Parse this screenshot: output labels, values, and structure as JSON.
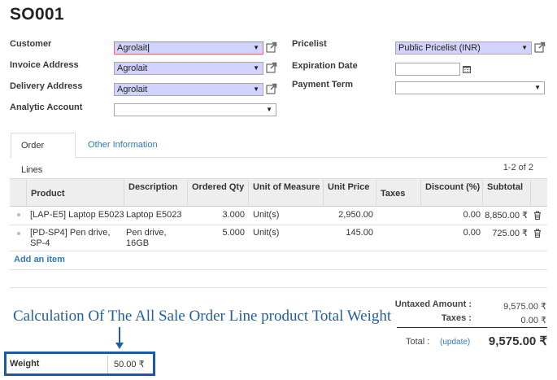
{
  "record": {
    "title": "SO001"
  },
  "left_fields": {
    "customer": {
      "label": "Customer",
      "value": "Agrolait"
    },
    "invoice_address": {
      "label": "Invoice Address",
      "value": "Agrolait"
    },
    "delivery_address": {
      "label": "Delivery Address",
      "value": "Agrolait"
    },
    "analytic_account": {
      "label": "Analytic Account",
      "value": ""
    }
  },
  "right_fields": {
    "pricelist": {
      "label": "Pricelist",
      "value": "Public Pricelist (INR)"
    },
    "expiration_date": {
      "label": "Expiration Date",
      "value": ""
    },
    "payment_term": {
      "label": "Payment Term",
      "value": ""
    }
  },
  "tabs": [
    {
      "label": "Order Lines",
      "active": true
    },
    {
      "label": "Other Information",
      "active": false
    }
  ],
  "pager": "1-2 of 2",
  "table": {
    "columns": [
      "Product",
      "Description",
      "Ordered Qty",
      "Unit of Measure",
      "Unit Price",
      "Taxes",
      "Discount (%)",
      "Subtotal"
    ],
    "rows": [
      {
        "product": [
          "[LAP-E5] Laptop E5023"
        ],
        "description": [
          "Laptop E5023"
        ],
        "qty": "3.000",
        "uom": "Unit(s)",
        "price": "2,950.00",
        "taxes": "",
        "discount": "0.00",
        "subtotal": "8,850.00 ₹"
      },
      {
        "product": [
          "[PD-SP4] Pen drive,",
          "SP-4"
        ],
        "description": [
          "Pen drive,",
          "16GB"
        ],
        "qty": "5.000",
        "uom": "Unit(s)",
        "price": "145.00",
        "taxes": "",
        "discount": "0.00",
        "subtotal": "725.00 ₹"
      }
    ],
    "add_item": "Add an item"
  },
  "totals": {
    "untaxed_label": "Untaxed Amount :",
    "untaxed_value": "9,575.00 ₹",
    "taxes_label": "Taxes :",
    "taxes_value": "0.00 ₹",
    "total_label": "Total :",
    "update_label": "(update)",
    "total_value": "9,575.00 ₹"
  },
  "annotation": "Calculation Of The All Sale Order Line product Total Weight",
  "weight": {
    "label": "Weight",
    "value": "50.00 ₹"
  },
  "colors": {
    "required_field": "#d2d2ff",
    "link": "#337ab7",
    "annotation": "#1f5fa6",
    "highlight_box": "#1a5aa8"
  }
}
